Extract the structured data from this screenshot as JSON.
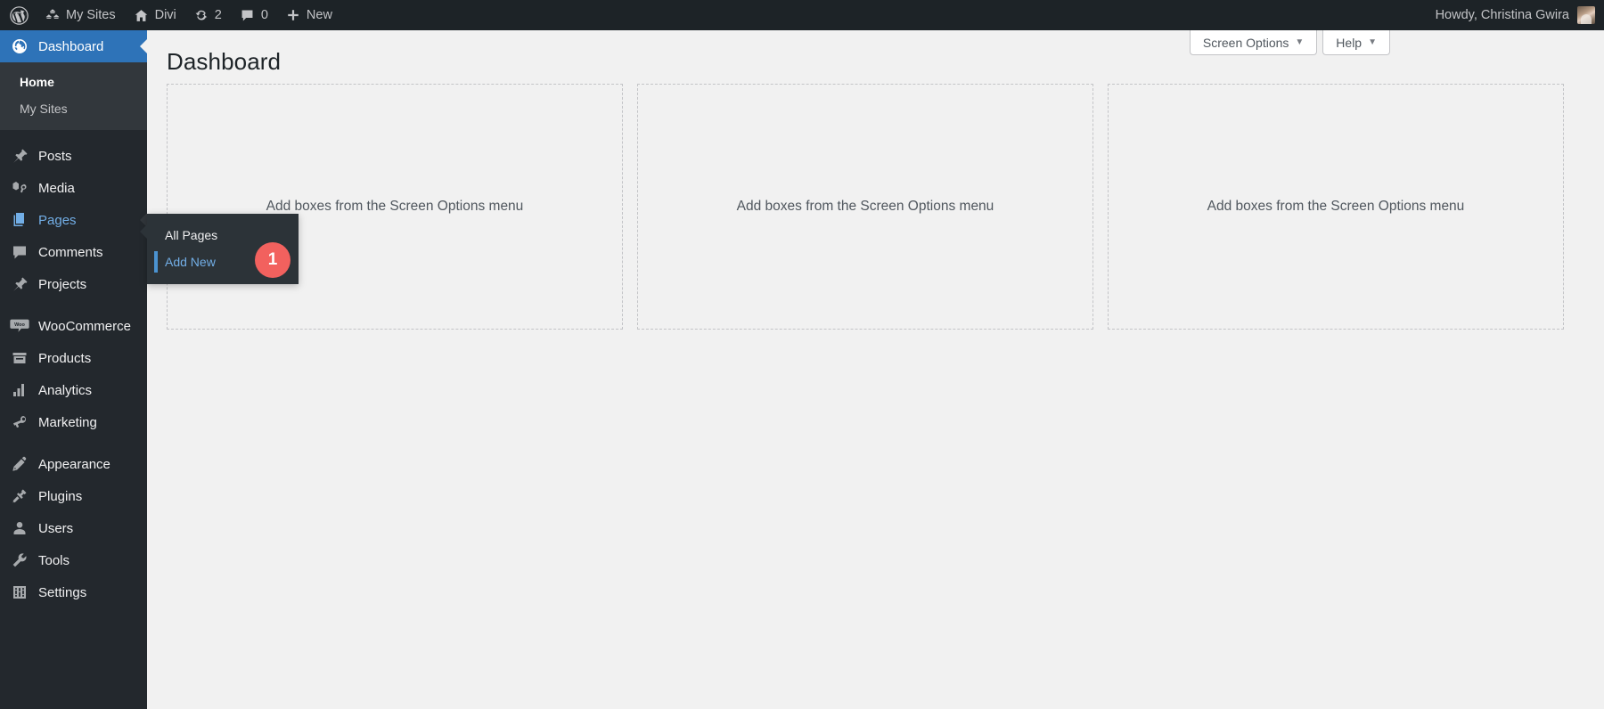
{
  "adminbar": {
    "wp_logo": "wordpress-logo-icon",
    "items": [
      {
        "icon": "sites-icon",
        "label": "My Sites"
      },
      {
        "icon": "home-icon",
        "label": "Divi"
      },
      {
        "icon": "updates-icon",
        "label": "2"
      },
      {
        "icon": "comments-icon",
        "label": "0"
      },
      {
        "icon": "plus-icon",
        "label": "New"
      }
    ],
    "howdy": "Howdy, Christina Gwira",
    "avatar": "user-avatar"
  },
  "sidebar": {
    "items": [
      {
        "label": "Dashboard",
        "icon": "dashboard-icon",
        "state": "current"
      },
      {
        "label": "Posts",
        "icon": "posts-pin-icon",
        "state": "normal"
      },
      {
        "label": "Media",
        "icon": "media-icon",
        "state": "normal"
      },
      {
        "label": "Pages",
        "icon": "pages-icon",
        "state": "open"
      },
      {
        "label": "Comments",
        "icon": "comments-icon",
        "state": "normal"
      },
      {
        "label": "Projects",
        "icon": "projects-pin-icon",
        "state": "normal"
      },
      {
        "label": "WooCommerce",
        "icon": "woocommerce-icon",
        "state": "normal"
      },
      {
        "label": "Products",
        "icon": "products-icon",
        "state": "normal"
      },
      {
        "label": "Analytics",
        "icon": "analytics-icon",
        "state": "normal"
      },
      {
        "label": "Marketing",
        "icon": "marketing-icon",
        "state": "normal"
      },
      {
        "label": "Appearance",
        "icon": "appearance-icon",
        "state": "normal"
      },
      {
        "label": "Plugins",
        "icon": "plugins-icon",
        "state": "normal"
      },
      {
        "label": "Users",
        "icon": "users-icon",
        "state": "normal"
      },
      {
        "label": "Tools",
        "icon": "tools-icon",
        "state": "normal"
      },
      {
        "label": "Settings",
        "icon": "settings-icon",
        "state": "normal"
      }
    ],
    "dashboard_submenu": [
      {
        "label": "Home",
        "current": true
      },
      {
        "label": "My Sites",
        "current": false
      }
    ]
  },
  "flyout": {
    "title": "Pages",
    "items": [
      {
        "label": "All Pages",
        "current": false
      },
      {
        "label": "Add New",
        "current": true
      }
    ],
    "badge": "1",
    "badge_color": "#f2615e"
  },
  "screen_meta": {
    "screen_options": "Screen Options",
    "help": "Help",
    "caret": "▼"
  },
  "main": {
    "title": "Dashboard",
    "columns": [
      {
        "hint": "Add boxes from the Screen Options menu"
      },
      {
        "hint": "Add boxes from the Screen Options menu"
      },
      {
        "hint": "Add boxes from the Screen Options menu"
      }
    ]
  },
  "colors": {
    "admin_bar": "#1d2327",
    "sidebar": "#23282d",
    "sidebar_submenu": "#32373c",
    "accent_blue": "#2e73b8",
    "link_blue": "#72aee6",
    "content_bg": "#f1f1f1"
  }
}
